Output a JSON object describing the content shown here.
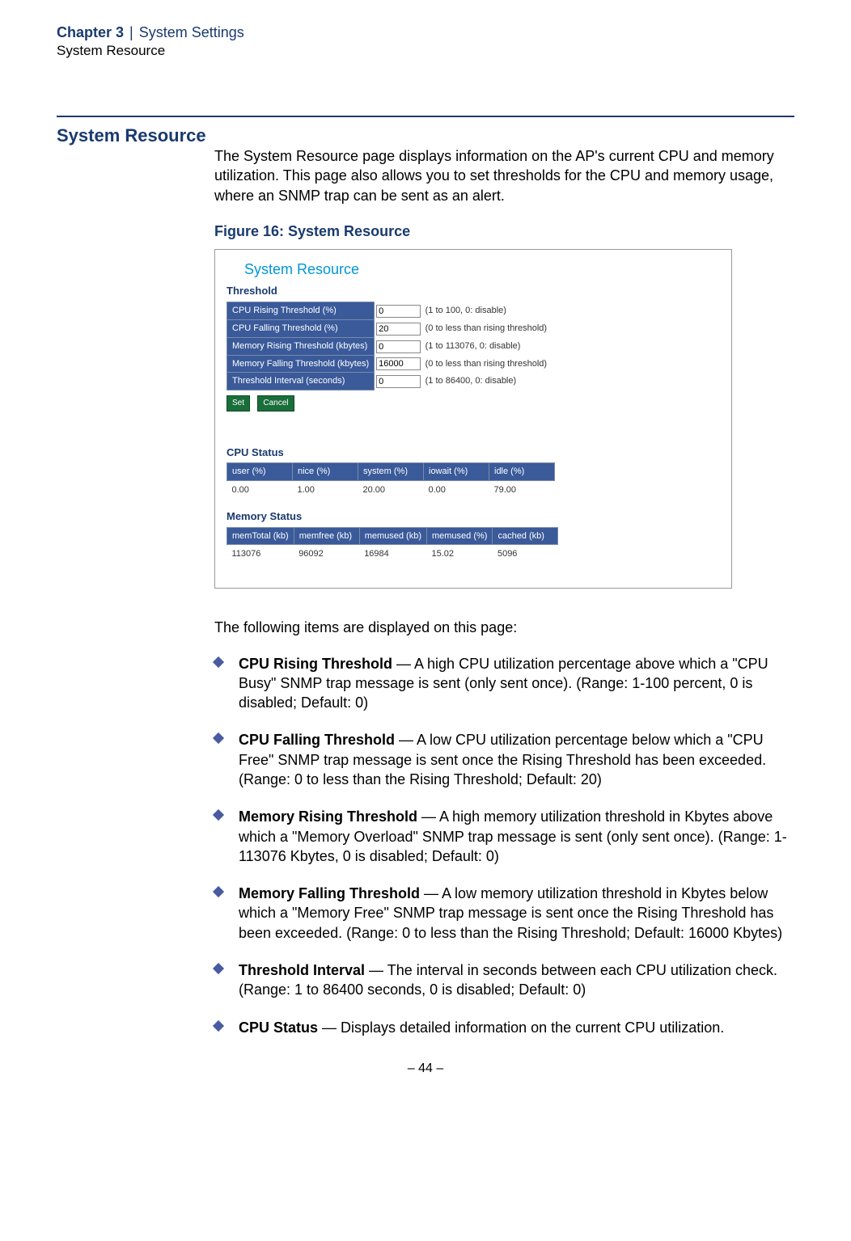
{
  "header": {
    "chapter": "Chapter 3",
    "separator": "|",
    "chapter_title": "System Settings",
    "subtitle": "System Resource"
  },
  "section_heading": "System Resource",
  "intro": "The System Resource page displays information on the AP's current CPU and memory utilization. This page also allows you to set thresholds for the CPU and memory usage, where an SNMP trap can be sent as an alert.",
  "figure_caption": "Figure 16:  System Resource",
  "screenshot": {
    "title": "System Resource",
    "threshold_heading": "Threshold",
    "rows": [
      {
        "label": "CPU Rising Threshold (%)",
        "value": "0",
        "hint": "(1 to 100, 0: disable)"
      },
      {
        "label": "CPU Falling Threshold (%)",
        "value": "20",
        "hint": "(0 to less than rising threshold)"
      },
      {
        "label": "Memory Rising Threshold (kbytes)",
        "value": "0",
        "hint": "(1 to 113076, 0: disable)"
      },
      {
        "label": "Memory Falling Threshold (kbytes)",
        "value": "16000",
        "hint": "(0 to less than rising threshold)"
      },
      {
        "label": "Threshold Interval (seconds)",
        "value": "0",
        "hint": "(1 to 86400, 0: disable)"
      }
    ],
    "buttons": {
      "set": "Set",
      "cancel": "Cancel"
    },
    "cpu_status": {
      "heading": "CPU Status",
      "headers": [
        "user (%)",
        "nice (%)",
        "system (%)",
        "iowait (%)",
        "idle (%)"
      ],
      "values": [
        "0.00",
        "1.00",
        "20.00",
        "0.00",
        "79.00"
      ]
    },
    "memory_status": {
      "heading": "Memory Status",
      "headers": [
        "memTotal (kb)",
        "memfree (kb)",
        "memused (kb)",
        "memused (%)",
        "cached (kb)"
      ],
      "values": [
        "113076",
        "96092",
        "16984",
        "15.02",
        "5096"
      ]
    }
  },
  "post_figure": "The following items are displayed on this page:",
  "items": [
    {
      "term": "CPU Rising Threshold",
      "desc": " — A high CPU utilization percentage above which a \"CPU Busy\" SNMP trap message is sent (only sent once). (Range: 1-100 percent, 0 is disabled; Default: 0)"
    },
    {
      "term": "CPU Falling Threshold",
      "desc": " — A low CPU utilization percentage below which a \"CPU Free\" SNMP trap message is sent once the Rising Threshold has been exceeded. (Range: 0 to less than the Rising Threshold; Default: 20)"
    },
    {
      "term": "Memory Rising Threshold",
      "desc": " — A high memory utilization threshold in Kbytes above which a \"Memory Overload\" SNMP trap message is sent (only sent once). (Range: 1-113076 Kbytes, 0 is disabled; Default: 0)"
    },
    {
      "term": "Memory Falling Threshold",
      "desc": " — A low memory utilization threshold in Kbytes below which a \"Memory Free\" SNMP trap message is sent once the Rising Threshold has been exceeded. (Range: 0 to less than the Rising Threshold; Default: 16000 Kbytes)"
    },
    {
      "term": "Threshold Interval",
      "desc": " — The interval in seconds between each CPU utilization check. (Range: 1 to 86400 seconds, 0 is disabled; Default: 0)"
    },
    {
      "term": "CPU Status",
      "desc": " — Displays detailed information on the current CPU utilization."
    }
  ],
  "footer": "–  44  –"
}
